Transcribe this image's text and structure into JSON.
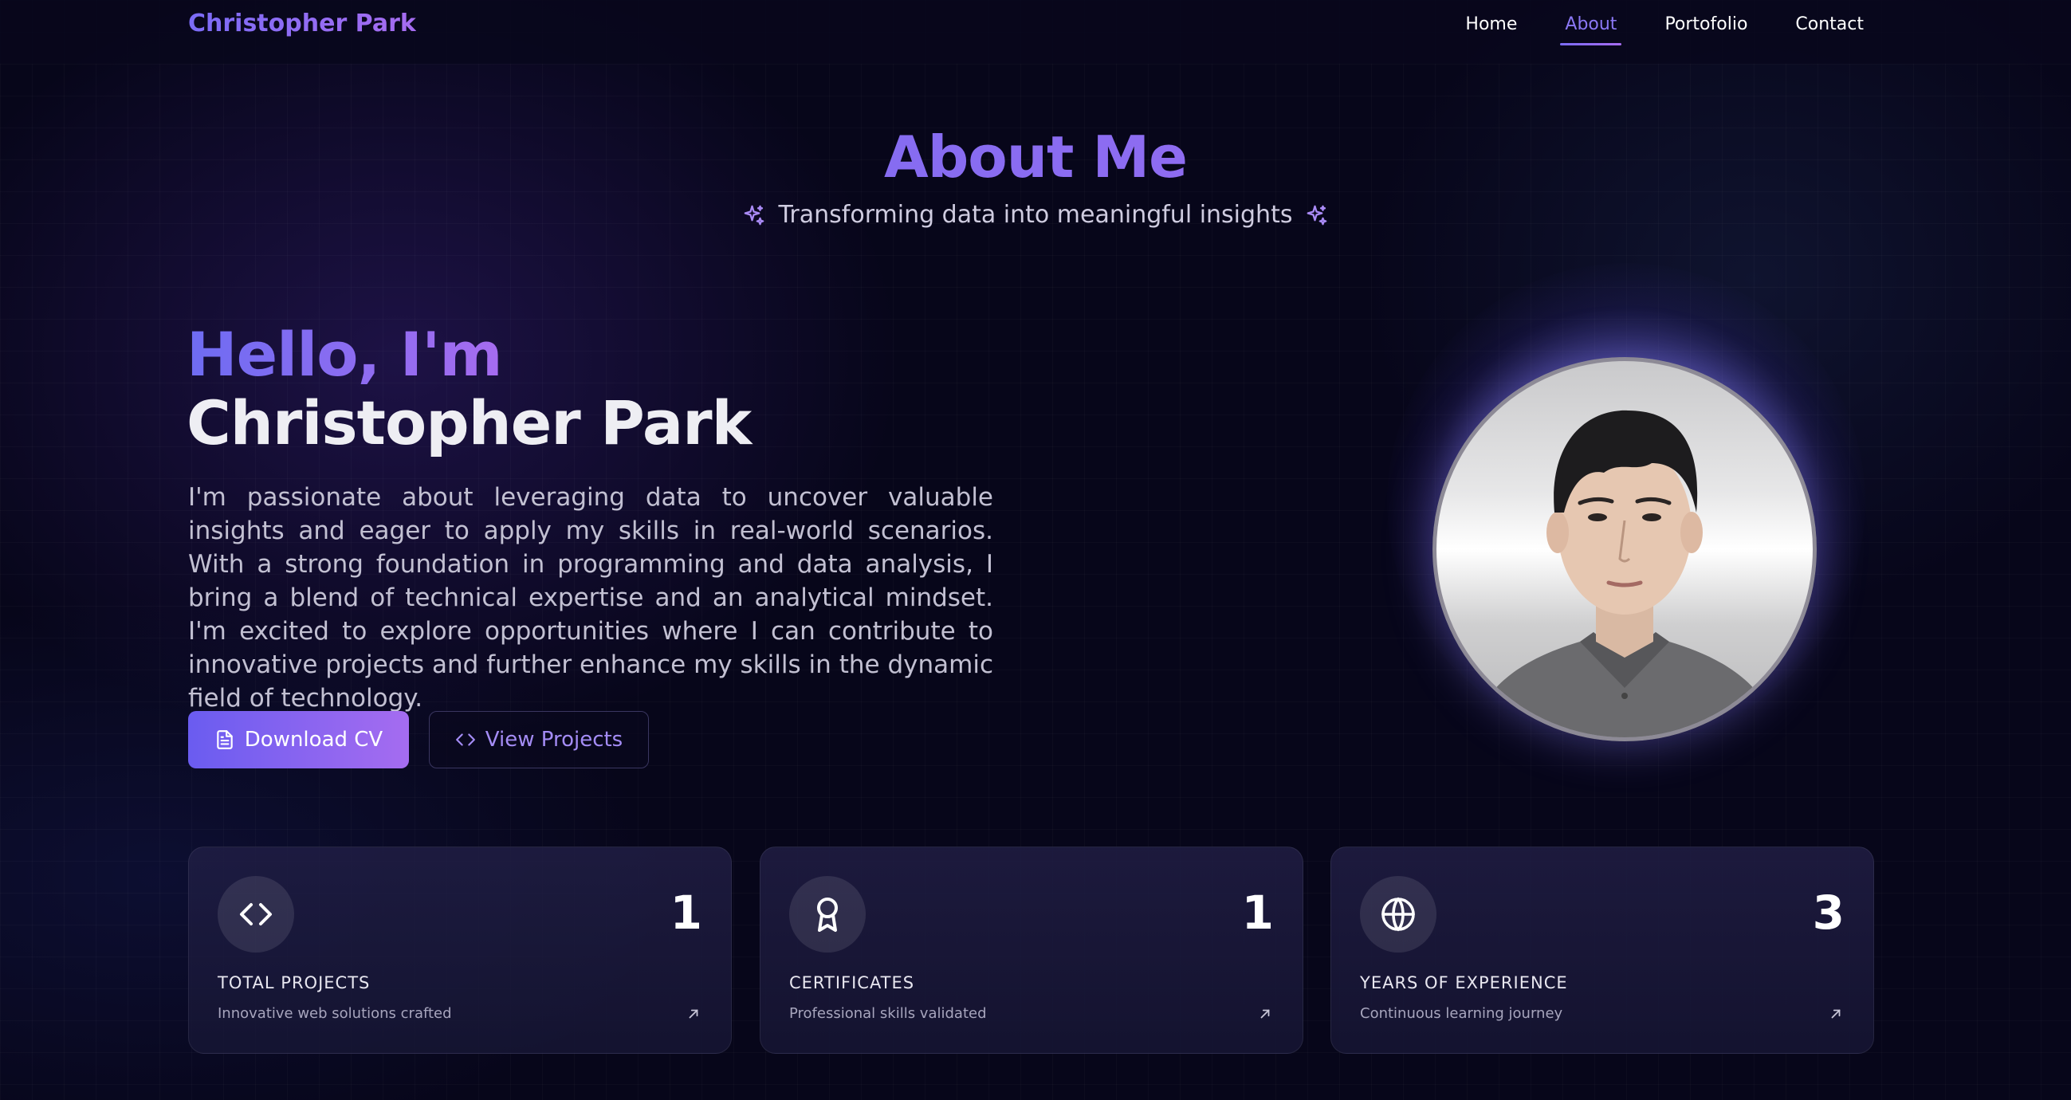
{
  "nav": {
    "brand": "Christopher Park",
    "links": [
      {
        "label": "Home",
        "active": false
      },
      {
        "label": "About",
        "active": true
      },
      {
        "label": "Portofolio",
        "active": false
      },
      {
        "label": "Contact",
        "active": false
      }
    ]
  },
  "header": {
    "title": "About Me",
    "subtitle": "Transforming data into meaningful insights"
  },
  "hero": {
    "greeting": "Hello, I'm",
    "name": "Christopher Park",
    "bio": "I'm passionate about leveraging data to uncover valuable insights and eager to apply my skills in real-world scenarios. With a strong foundation in programming and data analysis, I bring a blend of technical expertise and an analytical mindset. I'm excited to explore opportunities where I can contribute to innovative projects and further enhance my skills in the dynamic field of technology.",
    "download_label": "Download CV",
    "projects_label": "View Projects"
  },
  "stats": [
    {
      "icon": "code-icon",
      "value": "1",
      "label": "TOTAL PROJECTS",
      "desc": "Innovative web solutions crafted"
    },
    {
      "icon": "award-icon",
      "value": "1",
      "label": "CERTIFICATES",
      "desc": "Professional skills validated"
    },
    {
      "icon": "globe-icon",
      "value": "3",
      "label": "YEARS OF EXPERIENCE",
      "desc": "Continuous learning journey"
    }
  ],
  "colors": {
    "background": "#07061a",
    "accent_start": "#6e6cf2",
    "accent_end": "#a66cf0"
  }
}
